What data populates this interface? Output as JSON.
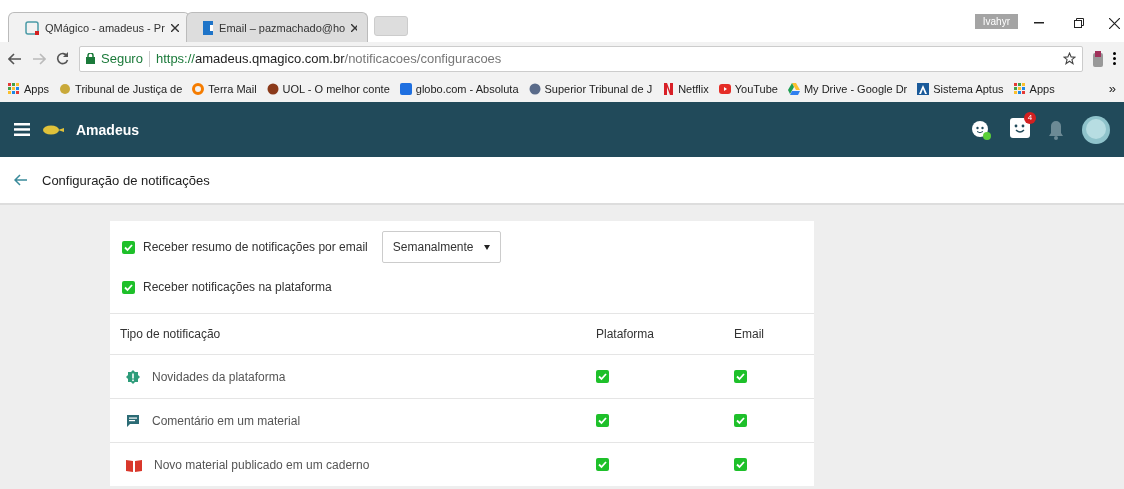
{
  "browser": {
    "tabs": [
      {
        "title": "QMágico - amadeus - Pr",
        "selected": true
      },
      {
        "title": "Email – pazmachado@ho",
        "selected": false
      }
    ],
    "profile": "Ivahyr",
    "address": {
      "security": "Seguro",
      "scheme": "https://",
      "host": "amadeus.qmagico.com.br",
      "path": "/notificacoes/configuracoes"
    },
    "bookmarks": [
      "Apps",
      "Tribunal de Justiça de",
      "Terra Mail",
      "UOL - O melhor conte",
      "globo.com - Absoluta",
      "Superior Tribunal de J",
      "Netflix",
      "YouTube",
      "My Drive - Google Dr",
      "Sistema Aptus",
      "Apps"
    ],
    "overflow": "»"
  },
  "app_bar": {
    "title": "Amadeus",
    "badge": "4"
  },
  "page": {
    "title": "Configuração de notificações"
  },
  "settings": [
    {
      "label": "Receber resumo de notificações por email",
      "checked": true,
      "select": "Semanalmente"
    },
    {
      "label": "Receber notificações na plataforma",
      "checked": true
    }
  ],
  "table": {
    "columns": [
      "Tipo de notificação",
      "Plataforma",
      "Email"
    ],
    "rows": [
      {
        "kind": "news",
        "label": "Novidades da plataforma",
        "platform": true,
        "email": true
      },
      {
        "kind": "comment",
        "label": "Comentário em um material",
        "platform": true,
        "email": true
      },
      {
        "kind": "book",
        "label": "Novo material publicado em um caderno",
        "platform": true,
        "email": true
      }
    ]
  }
}
